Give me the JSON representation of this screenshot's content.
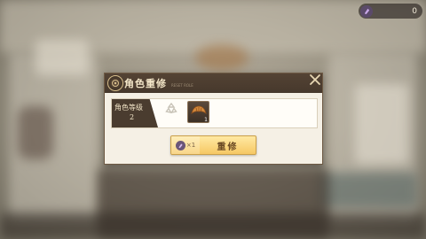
{
  "currency": {
    "icon": "crystal-icon",
    "amount": "0"
  },
  "dialog": {
    "title": "角色重修",
    "subtitle": "RESET ROLE",
    "level_label": "角色等级",
    "level_value": "2",
    "material": {
      "icon": "croissant-icon",
      "count": "1"
    },
    "reset_button": {
      "cost_icon": "crystal-icon",
      "cost": "×1",
      "label": "重修"
    }
  },
  "colors": {
    "header": "#46382c",
    "panel": "#f5f0e5",
    "button": "#f6c863",
    "title_text": "#f3e6c8"
  }
}
